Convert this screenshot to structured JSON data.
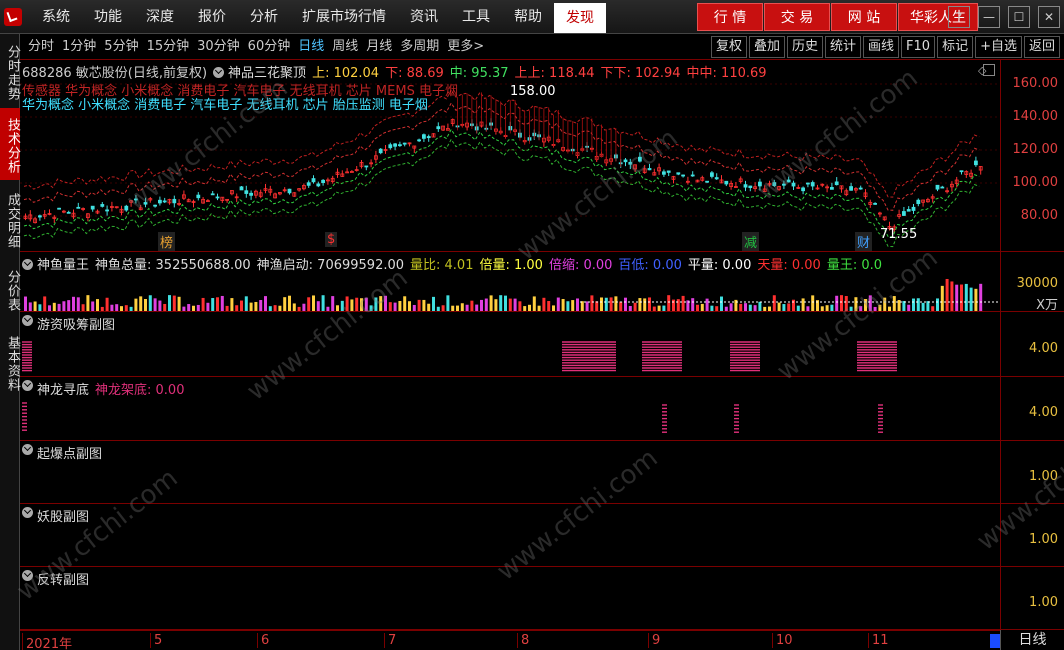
{
  "menu": {
    "items": [
      "系统",
      "功能",
      "深度",
      "报价",
      "分析",
      "扩展市场行情",
      "资讯",
      "工具",
      "帮助"
    ],
    "active": "发现"
  },
  "right_tabs": [
    "行 情",
    "交 易",
    "网 站",
    "华彩人生"
  ],
  "window_controls": [
    "?",
    "—",
    "☐",
    "✕"
  ],
  "left_tabs": [
    "分时走势",
    "技术分析",
    "成交明细",
    "分价表",
    "基本资料"
  ],
  "periods": [
    "分时",
    "1分钟",
    "5分钟",
    "15分钟",
    "30分钟",
    "60分钟",
    "日线",
    "周线",
    "月线",
    "多周期",
    "更多>"
  ],
  "active_period": "日线",
  "tools": [
    "复权",
    "叠加",
    "历史",
    "统计",
    "画线",
    "F10",
    "标记",
    "+自选",
    "返回"
  ],
  "main": {
    "stock": "688286 敏芯股份(日线,前复权)",
    "indicator": "神品三花聚顶",
    "up_label": "上: 102.04",
    "down_label": "下: 88.69",
    "mid_label": "中: 95.37",
    "upup_label": "上上: 118.44",
    "downdown_label": "下下: 102.94",
    "midmid_label": "中中: 110.69",
    "concepts_line1": "传感器  华为概念  小米概念  消费电子  汽车电子  无线耳机  芯片  MEMS  电子烟",
    "concepts_line2": "华为概念  小米概念  消费电子  汽车电子  无线耳机  芯片  胎压监测  电子烟",
    "high_marker": "158.00",
    "low_marker": "71.55",
    "signals": [
      {
        "label": "榜",
        "color": "#e8a030"
      },
      {
        "label": "$",
        "color": "#ff3030"
      },
      {
        "label": "减",
        "color": "#20c040"
      },
      {
        "label": "财",
        "color": "#40a0ff"
      }
    ],
    "y_ticks": [
      "160.00",
      "140.00",
      "120.00",
      "100.00",
      "80.00"
    ],
    "price_ticks": [
      160,
      140,
      120,
      100,
      80
    ]
  },
  "volume_panel": {
    "title": "神鱼量王",
    "total": "神鱼总量: 352550688.00",
    "start": "神渔启动: 70699592.00",
    "liangbi": "量比: 4.01",
    "beiliang": "倍量: 1.00",
    "beisuo": "倍缩: 0.00",
    "bai": "百低: 0.00",
    "ping": "平量: 0.00",
    "tian": "天量: 0.00",
    "wang": "量王: 0.0",
    "tick": "30000",
    "unit": "X万"
  },
  "panels": [
    {
      "title": "游资吸筹副图",
      "tick": "4.00"
    },
    {
      "title": "神龙寻底",
      "sub": "神龙架底: 0.00",
      "tick": "4.00"
    },
    {
      "title": "起爆点副图",
      "tick": "1.00"
    },
    {
      "title": "妖股副图",
      "tick": "1.00"
    },
    {
      "title": "反转副图",
      "tick": "1.00"
    }
  ],
  "time_axis": [
    "2021年",
    "5",
    "6",
    "7",
    "8",
    "9",
    "10",
    "11"
  ],
  "day_button": "日线",
  "watermark": "www.cfchi.com",
  "colors": {
    "up": "#ff3030",
    "down": "#40e0e0",
    "accent": "#c81010",
    "active_period": "#4fc3ff"
  }
}
